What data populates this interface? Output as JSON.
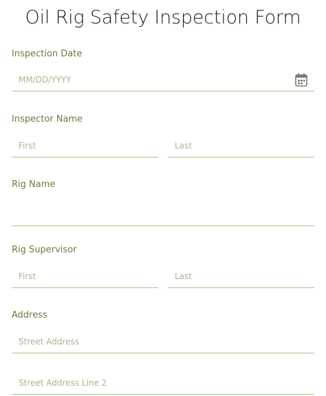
{
  "form": {
    "title": "Oil Rig Safety Inspection Form",
    "inspection_date": {
      "label": "Inspection Date",
      "placeholder": "MM/DD/YYYY",
      "icon": "calendar-icon"
    },
    "inspector_name": {
      "label": "Inspector Name",
      "first_placeholder": "First",
      "last_placeholder": "Last"
    },
    "rig_name": {
      "label": "Rig Name",
      "placeholder": ""
    },
    "rig_supervisor": {
      "label": "Rig Supervisor",
      "first_placeholder": "First",
      "last_placeholder": "Last"
    },
    "address": {
      "label": "Address",
      "street_placeholder": "Street Address",
      "street2_placeholder": "Street Address Line 2"
    }
  },
  "colors": {
    "label": "#6b7a42",
    "underline": "#a7c48d",
    "placeholder": "#a9b58e"
  }
}
